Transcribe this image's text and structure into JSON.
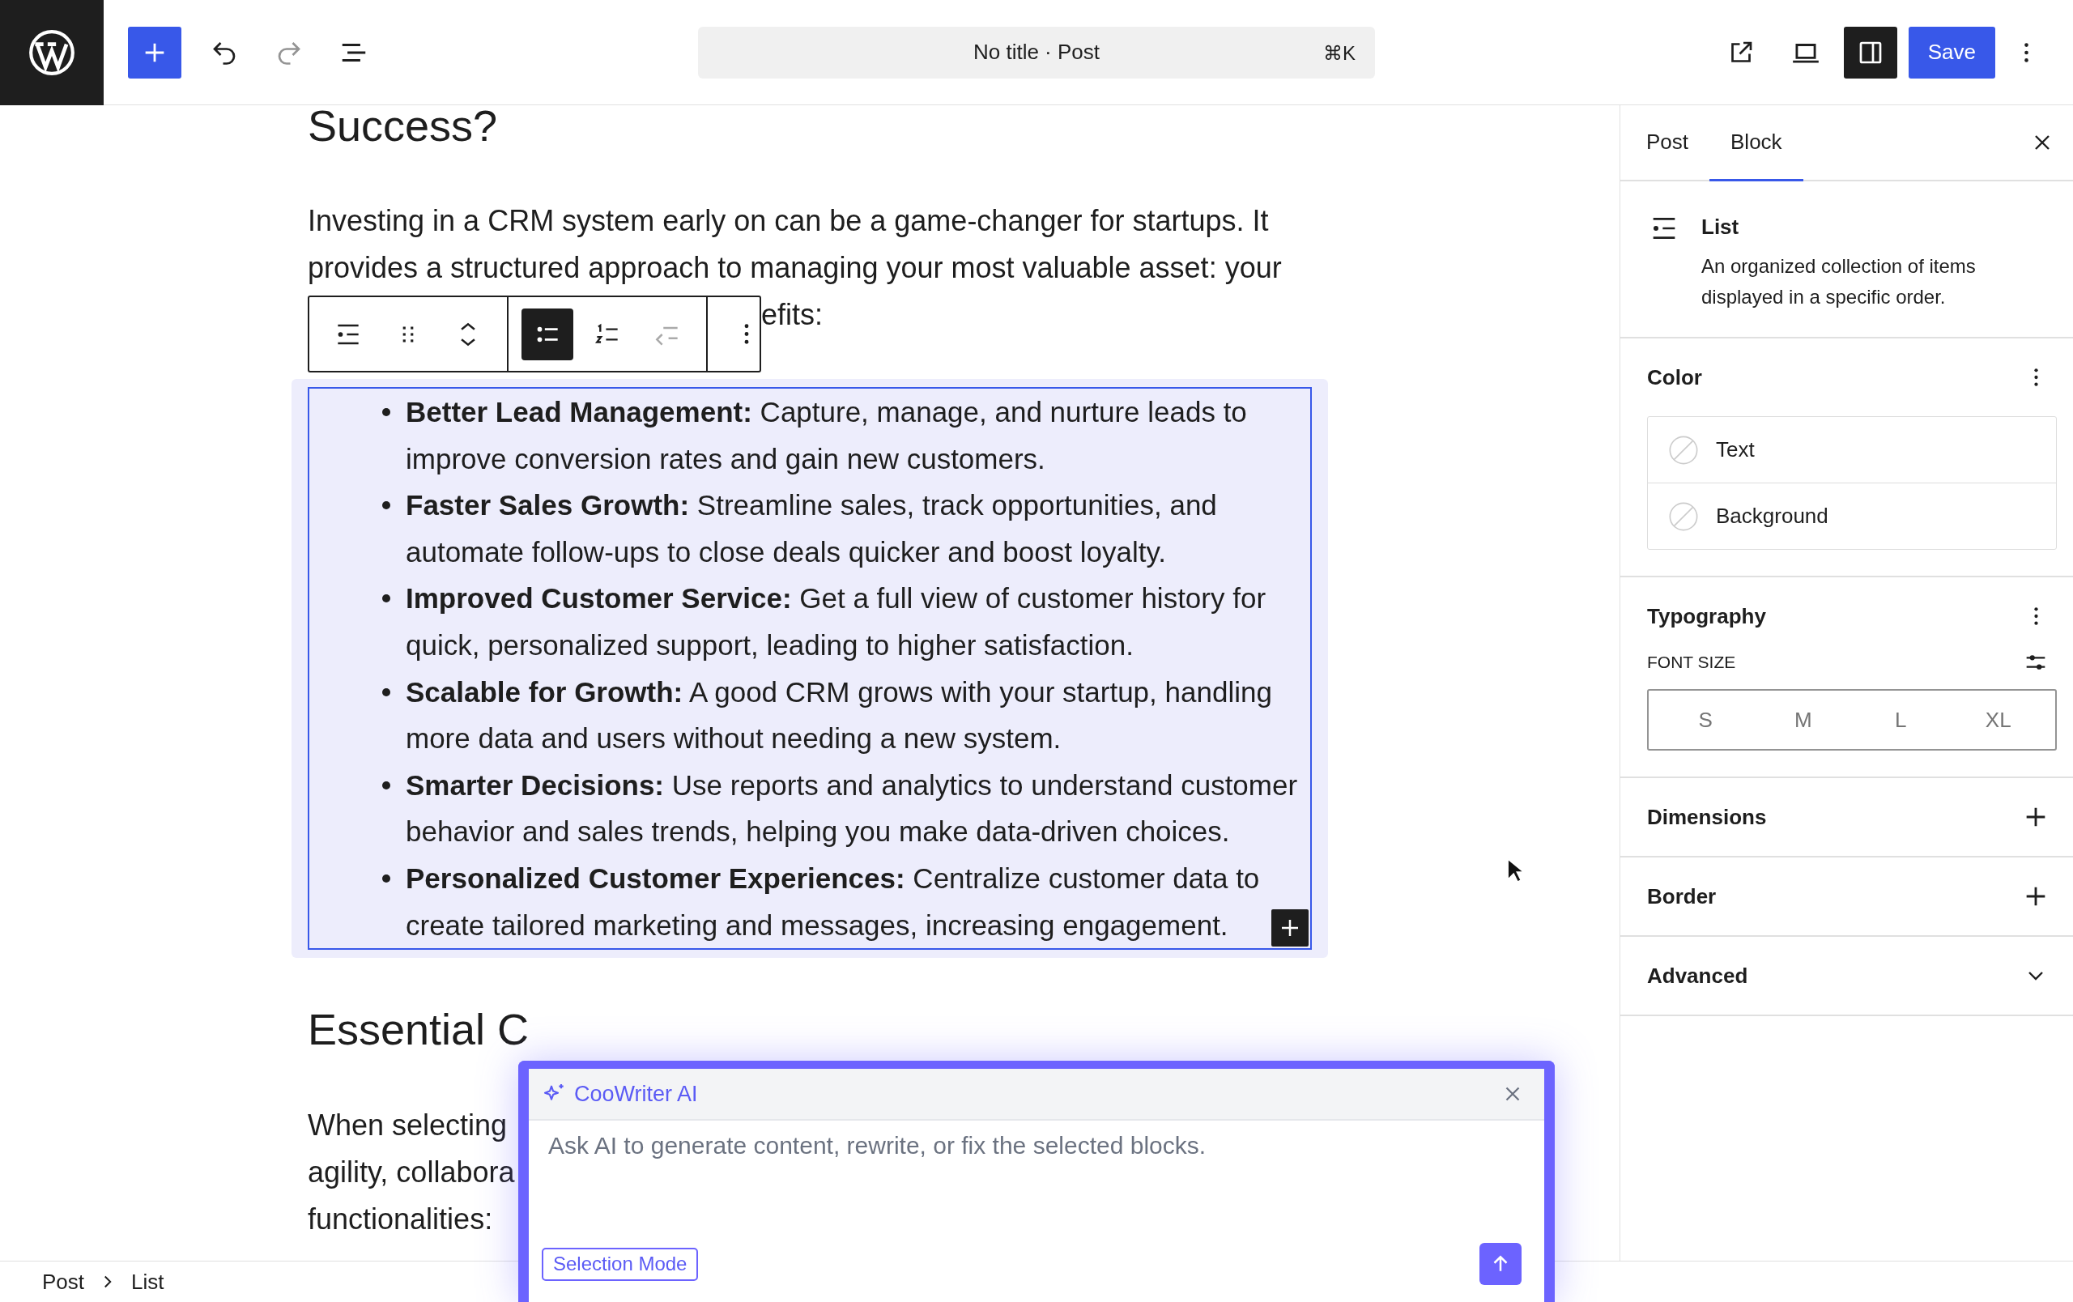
{
  "topbar": {
    "undo": {
      "disabled": false
    },
    "redo": {
      "disabled": true
    },
    "command": {
      "title": "No title · Post",
      "shortcut": "⌘K"
    },
    "sidebar_toggle": {
      "on": true
    },
    "save": "Save"
  },
  "editor": {
    "heading": "Success?",
    "intro_lines": [
      "Investing in a CRM system early on can be a game-changer for startups. It",
      "provides a structured approach to managing your most valuable asset: your"
    ],
    "block_toolbar": {
      "groups": [
        [
          {
            "kind": "block-type"
          },
          {
            "kind": "drag"
          },
          {
            "kind": "move"
          }
        ],
        [
          {
            "kind": "unordered",
            "selected": true
          },
          {
            "kind": "ordered",
            "selected": false
          },
          {
            "kind": "outdent",
            "disabled": true
          }
        ],
        [
          {
            "kind": "more"
          }
        ]
      ],
      "text_after": "efits:"
    },
    "list": {
      "selected": true,
      "items": [
        "**Better Lead Management:** Capture, manage, and nurture leads to improve conversion rates and gain new customers.",
        "**Faster Sales Growth:** Streamline sales, track opportunities, and automate follow-ups to close deals quicker and boost loyalty.",
        "**Improved Customer Service:** Get a full view of customer history for quick, personalized support, leading to higher satisfaction.",
        "**Scalable for Growth:** A good CRM grows with your startup, handling more data and users without needing a new system.",
        "**Smarter Decisions:** Use reports and analytics to understand customer behavior and sales trends, helping you make data-driven choices.",
        "**Personalized Customer Experiences:** Centralize customer data to create tailored marketing and messages, increasing engagement."
      ]
    },
    "heading2": "Essential C",
    "outro_lines": [
      "When selecting",
      "agility, collabora",
      "functionalities:"
    ]
  },
  "sidebar": {
    "tabs": [
      {
        "label": "Post",
        "selected": false
      },
      {
        "label": "Block",
        "selected": true
      }
    ],
    "block": {
      "name": "List",
      "description": "An organized collection of items displayed in a specific order."
    },
    "panels": [
      {
        "kind": "color",
        "title": "Color",
        "expanded": true,
        "items": [
          "Text",
          "Background"
        ]
      },
      {
        "kind": "typography",
        "title": "Typography",
        "expanded": true,
        "font_size_label": "FONT SIZE",
        "sizes": [
          {
            "label": "S",
            "selected": false
          },
          {
            "label": "M",
            "selected": false
          },
          {
            "label": "L",
            "selected": false
          },
          {
            "label": "XL",
            "selected": false
          }
        ]
      },
      {
        "kind": "tools",
        "title": "Dimensions",
        "expanded": false
      },
      {
        "kind": "tools",
        "title": "Border",
        "expanded": false
      },
      {
        "kind": "advanced",
        "title": "Advanced",
        "expanded": false
      }
    ]
  },
  "breadcrumb": [
    "Post",
    "List"
  ],
  "ai_panel": {
    "title": "CooWriter AI",
    "placeholder": "Ask AI to generate content, rewrite, or fix the selected blocks.",
    "mode_button": "Selection Mode"
  }
}
